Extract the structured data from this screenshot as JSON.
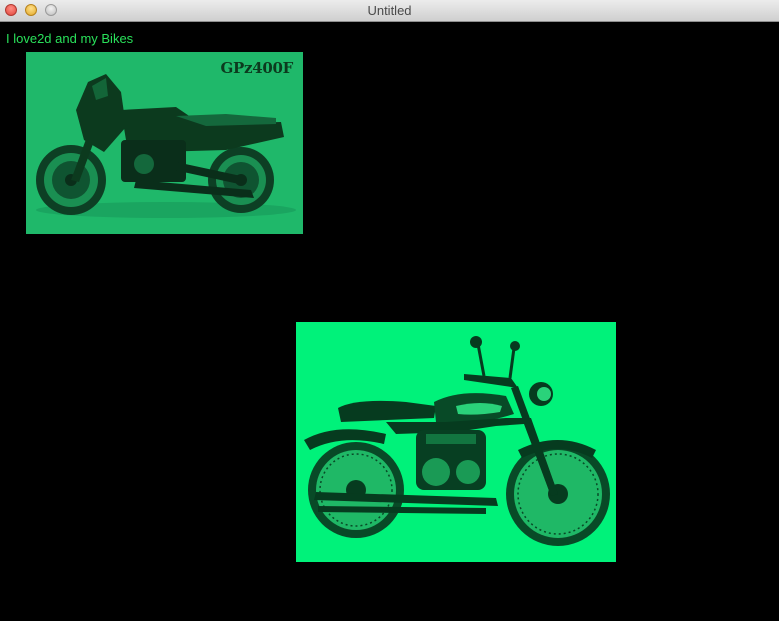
{
  "window": {
    "title": "Untitled"
  },
  "caption": {
    "text": "I love2d and my Bikes"
  },
  "images": [
    {
      "name": "gpz400f-photo",
      "label": "GPz400F",
      "tint": "#1fb86a"
    },
    {
      "name": "classic-bike-photo",
      "tint": "#00f27a"
    }
  ],
  "colors": {
    "background": "#000000",
    "caption": "#29e05a"
  }
}
